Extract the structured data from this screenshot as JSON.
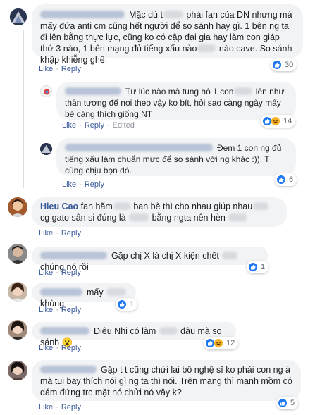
{
  "comments": [
    {
      "id": "c1",
      "name": "",
      "segments": [
        {
          "t": "Mặc dù t"
        },
        {
          "blur": true
        },
        {
          "t": " phải fan của DN nhưng mà mấy đứa anti cm cũng hết người để so sánh hay gì. 1 bên ng ta đi lên bằng thực lực, cũng ko có cập đại gia hay làm con giáp thứ 3 nào, 1 bên mạng đủ tiếng xấu nào"
        },
        {
          "blur": true
        },
        {
          "t": " nào cave. So sánh khập khiễng ghê."
        }
      ],
      "actions": {
        "like": "Like",
        "reply": "Reply"
      },
      "reactions": {
        "types": [
          "like-icon"
        ],
        "count": "30"
      }
    },
    {
      "id": "c2",
      "name": "",
      "segments": [
        {
          "t": "Từ lúc nào mà tung hô 1 con"
        },
        {
          "blur": true
        },
        {
          "t": " lên như thần tượng để noi theo vậy ko bít, hỏi sao càng ngày mấy bé càng thích giống NT"
        }
      ],
      "actions": {
        "like": "Like",
        "reply": "Reply",
        "edited": "Edited"
      },
      "reactions": {
        "types": [
          "like-icon",
          "haha-icon"
        ],
        "count": "14"
      }
    },
    {
      "id": "c3",
      "name": "",
      "segments": [
        {
          "t": "Đem 1 con ng đủ tiếng xấu làm chuẩn mực để so sánh với ng khác :)). T cũng chịu bọn đó."
        }
      ],
      "actions": {
        "like": "Like",
        "reply": "Reply"
      },
      "reactions": {
        "types": [
          "like-icon"
        ],
        "count": "6"
      }
    },
    {
      "id": "c4",
      "name": "Hieu Cao",
      "segments": [
        {
          "t": "fan hãm"
        },
        {
          "blur": true
        },
        {
          "t": " ban bè thì cho nhau giúp nhau"
        },
        {
          "blur": true
        },
        {
          "t": " cg gato sân si đúng là "
        },
        {
          "blur": true
        },
        {
          "t": " bằng ngta nên hèn "
        },
        {
          "blur": true
        }
      ],
      "actions": {
        "like": "Like",
        "reply": "Reply"
      },
      "reactions": null
    },
    {
      "id": "c5",
      "name": "",
      "segments": [
        {
          "t": "Gặp chị X là chị X kiện chết "
        },
        {
          "blur": true
        },
        {
          "t": " chúng nó rồi"
        }
      ],
      "actions": {
        "like": "Like",
        "reply": "Reply"
      },
      "reactions": {
        "types": [
          "like-icon"
        ],
        "count": "1"
      }
    },
    {
      "id": "c6",
      "name": "",
      "segments": [
        {
          "t": "mấy "
        },
        {
          "blur": true
        },
        {
          "t": " khùng"
        }
      ],
      "actions": {
        "like": "Like",
        "reply": "Reply"
      },
      "reactions": {
        "types": [
          "like-icon"
        ],
        "count": "1"
      }
    },
    {
      "id": "c7",
      "name": "",
      "segments": [
        {
          "t": "Diêu Nhi có làm "
        },
        {
          "blur": true
        },
        {
          "t": " đâu mà so sánh 😮"
        }
      ],
      "actions": {
        "like": "Like",
        "reply": "Reply"
      },
      "reactions": {
        "types": [
          "like-icon",
          "haha-icon"
        ],
        "count": "12"
      }
    },
    {
      "id": "c8",
      "name": "",
      "segments": [
        {
          "t": "Gặp t t cũng chửi lại bô nghệ sĩ ko phải con ng à mà tui bay thích nói gì ng ta thì nói. Trên mạng thì mạnh mồm có dám đứng trc mặt nó chửi nó vậy k?"
        }
      ],
      "actions": {
        "like": "Like",
        "reply": "Reply"
      },
      "reactions": {
        "types": [
          "like-icon"
        ],
        "count": "5"
      }
    }
  ]
}
